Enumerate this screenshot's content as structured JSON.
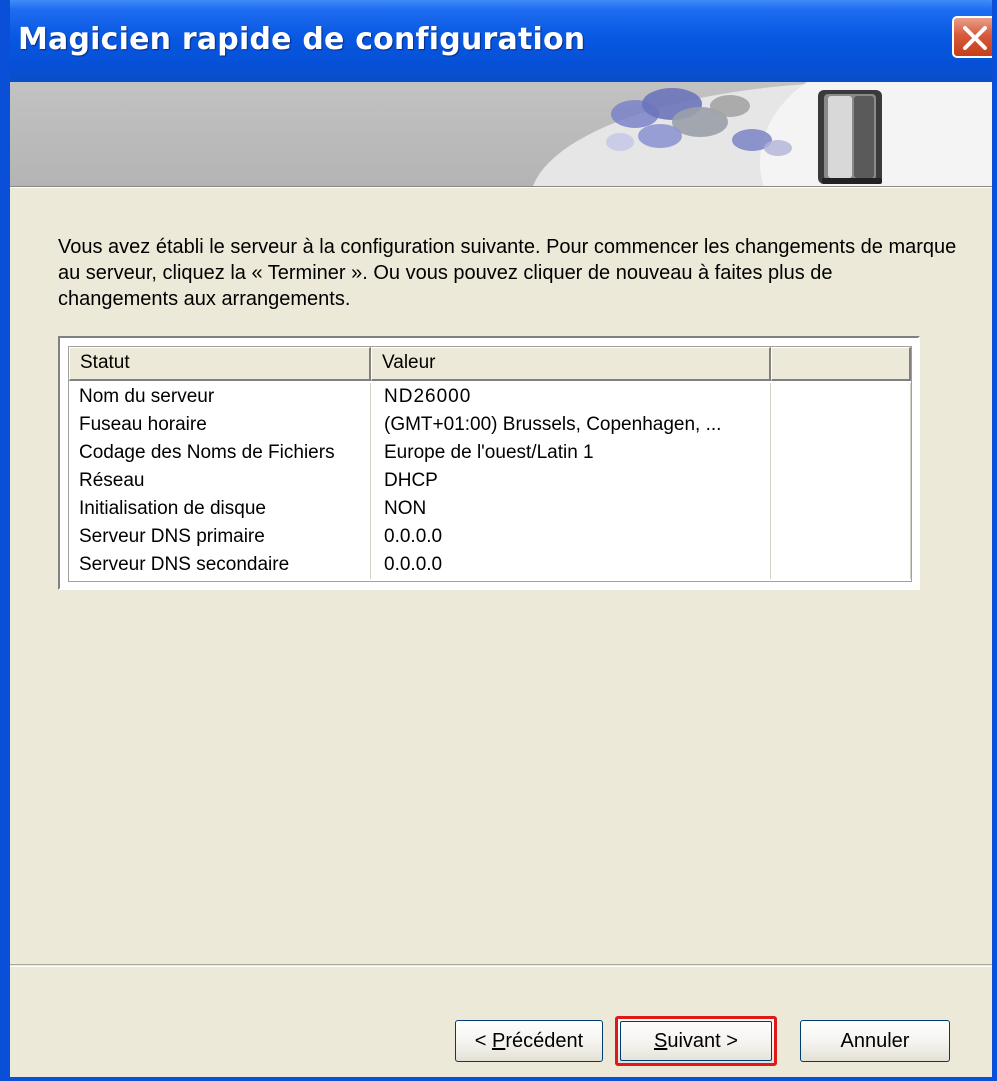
{
  "window": {
    "title": "Magicien rapide de configuration"
  },
  "intro": {
    "text": "Vous avez établi le serveur à la configuration suivante.  Pour commencer les changements de marque au serveur, cliquez la « Terminer ». Ou vous pouvez cliquer de nouveau à faites plus de changements aux arrangements."
  },
  "table": {
    "headers": [
      "Statut",
      "Valeur",
      ""
    ],
    "rows": [
      {
        "statut": "Nom du serveur",
        "valeur": "ND26000"
      },
      {
        "statut": "Fuseau horaire",
        "valeur": "(GMT+01:00) Brussels, Copenhagen, ..."
      },
      {
        "statut": "Codage des Noms de Fichiers",
        "valeur": "Europe de l'ouest/Latin 1"
      },
      {
        "statut": "Réseau",
        "valeur": "DHCP"
      },
      {
        "statut": "Initialisation de disque",
        "valeur": "NON"
      },
      {
        "statut": "Serveur DNS primaire",
        "valeur": "0.0.0.0"
      },
      {
        "statut": "Serveur DNS secondaire",
        "valeur": "0.0.0.0"
      }
    ]
  },
  "buttons": {
    "prev_prefix": "< ",
    "prev_mnemonic": "P",
    "prev_rest": "récédent",
    "next_mnemonic": "S",
    "next_rest": "uivant >",
    "cancel": "Annuler"
  },
  "colors": {
    "titlebar": "#0858e2",
    "highlight_border": "#e01818",
    "dialog_bg": "#ece9d8"
  },
  "icons": {
    "close": "close-icon",
    "banner": "hard-drive-icon"
  }
}
